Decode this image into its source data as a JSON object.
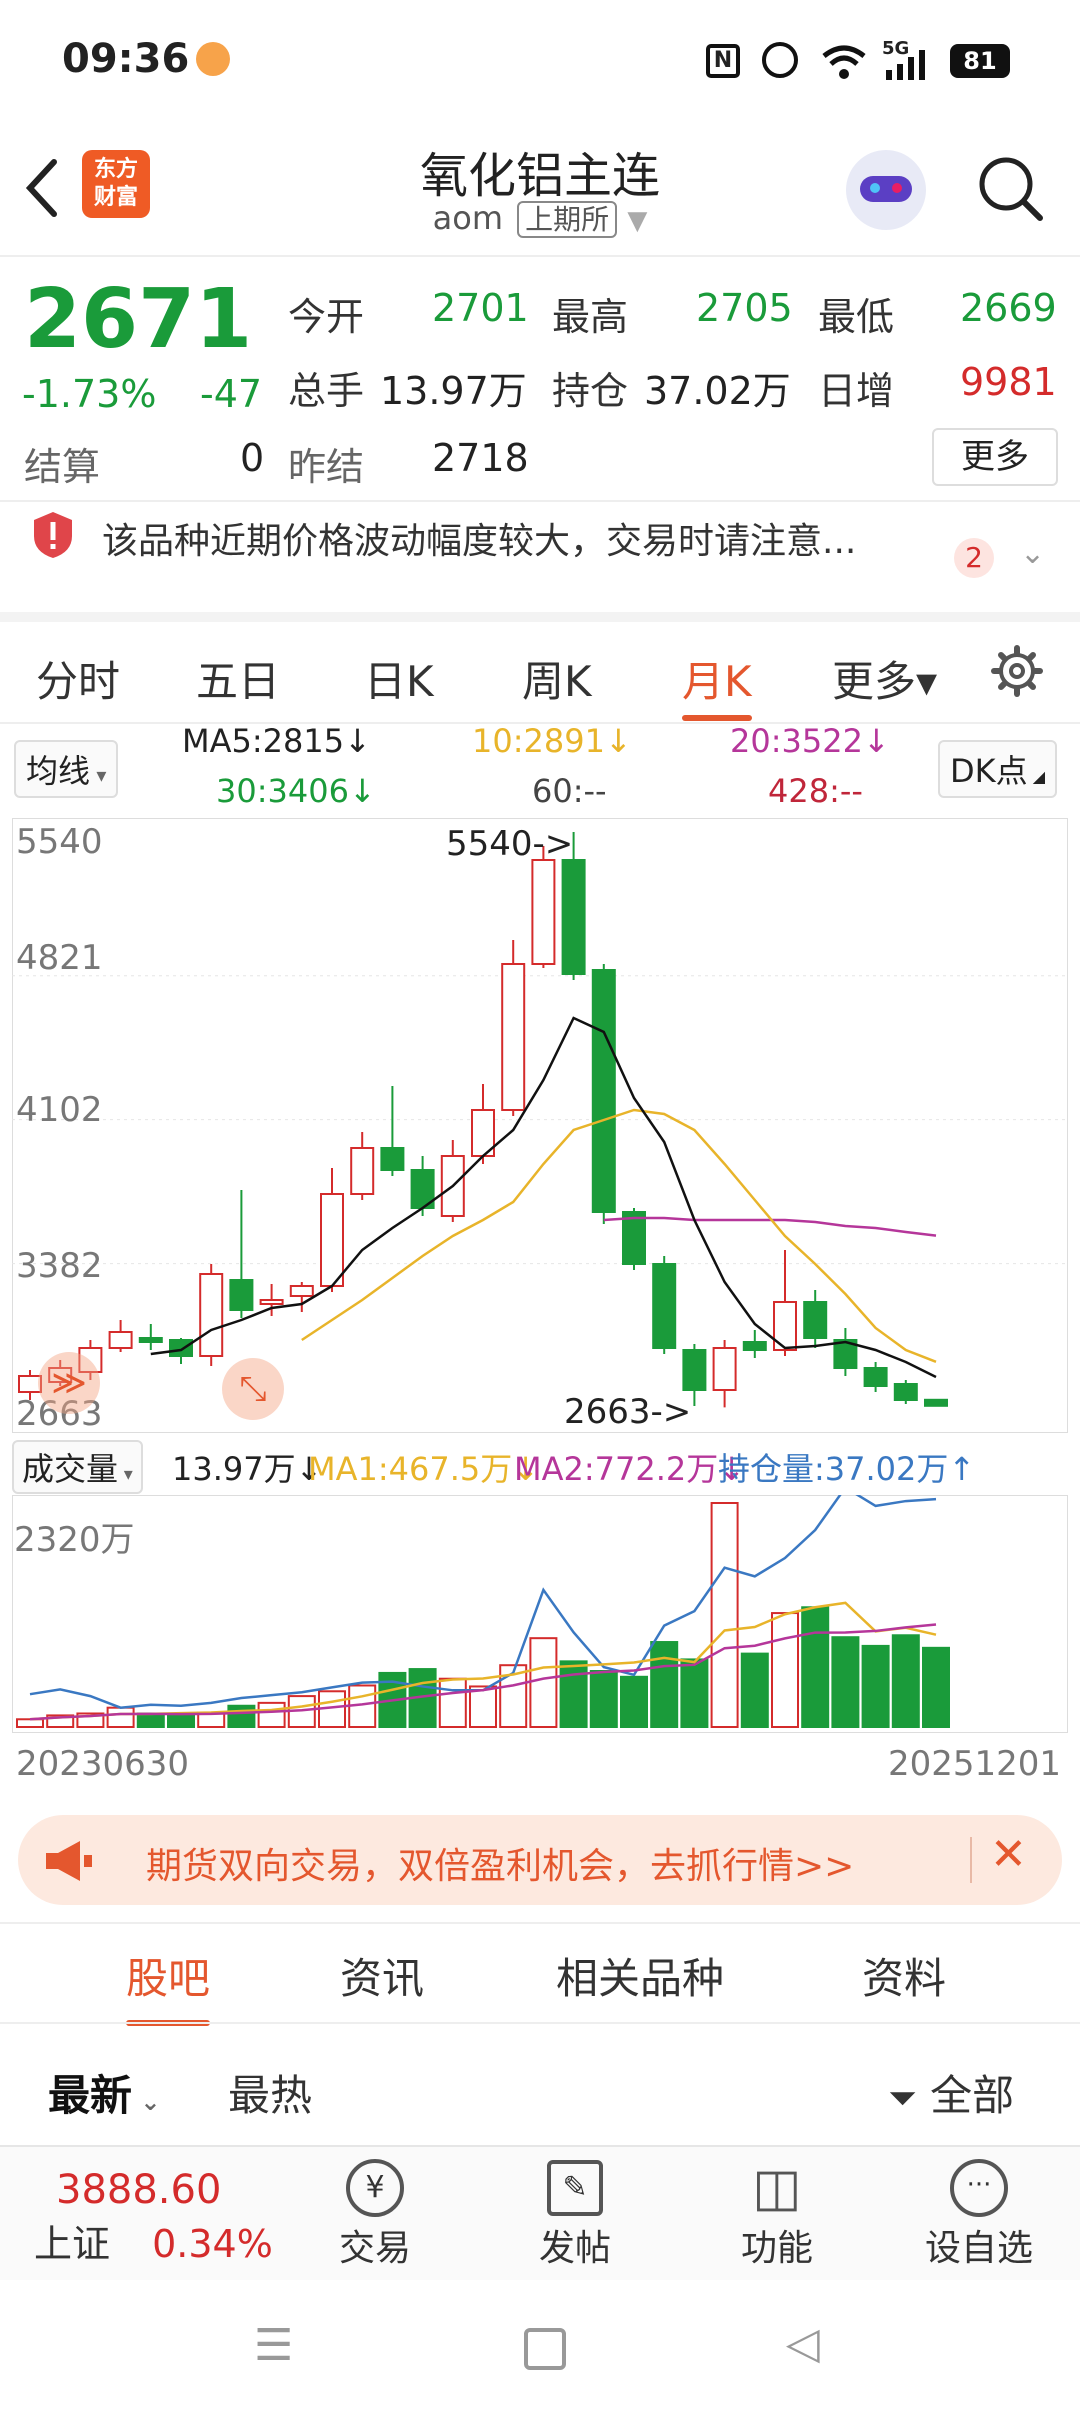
{
  "status_bar": {
    "time": "09:36",
    "battery": "81",
    "network": "5G"
  },
  "header": {
    "logo_line1": "东方",
    "logo_line2": "财富",
    "title": "氧化铝主连",
    "code": "aom",
    "exchange": "上期所"
  },
  "quote": {
    "price": "2671",
    "change_pct": "-1.73%",
    "change": "-47",
    "open_label": "今开",
    "open": "2701",
    "high_label": "最高",
    "high": "2705",
    "low_label": "最低",
    "low": "2669",
    "volume_label": "总手",
    "volume": "13.97万",
    "oi_label": "持仓",
    "oi": "37.02万",
    "daily_inc_label": "日增",
    "daily_inc": "9981",
    "settle_label": "结算",
    "settle": "0",
    "prev_settle_label": "昨结",
    "prev_settle": "2718",
    "more_label": "更多"
  },
  "warning": {
    "text": "该品种近期价格波动幅度较大，交易时请注意...",
    "count": "2"
  },
  "period_tabs": [
    "分时",
    "五日",
    "日K",
    "周K",
    "月K",
    "更多▾"
  ],
  "active_period": "月K",
  "ma": {
    "selector": "均线",
    "ma5": "MA5:2815↓",
    "ma10": "10:2891↓",
    "ma20": "20:3522↓",
    "ma30": "30:3406↓",
    "ma60": "60:--",
    "ma428": "428:--",
    "dk_label": "DK点"
  },
  "chart_data": {
    "type": "candlestick",
    "y_ticks": [
      "5540",
      "4821",
      "4102",
      "3382",
      "2663"
    ],
    "ylim": [
      2663,
      5540
    ],
    "high_annotation": "5540->",
    "low_annotation": "2663->",
    "x_start_label": "20230630",
    "x_end_label": "20251201",
    "candles": [
      {
        "o": 2740,
        "c": 2820,
        "h": 2850,
        "l": 2700
      },
      {
        "o": 2790,
        "c": 2860,
        "h": 2900,
        "l": 2770
      },
      {
        "o": 2840,
        "c": 2960,
        "h": 3000,
        "l": 2800
      },
      {
        "o": 2960,
        "c": 3040,
        "h": 3100,
        "l": 2940
      },
      {
        "o": 3010,
        "c": 2990,
        "h": 3080,
        "l": 2950
      },
      {
        "o": 3000,
        "c": 2920,
        "h": 3010,
        "l": 2880
      },
      {
        "o": 2920,
        "c": 3330,
        "h": 3380,
        "l": 2870
      },
      {
        "o": 3300,
        "c": 3150,
        "h": 3750,
        "l": 3110
      },
      {
        "o": 3180,
        "c": 3200,
        "h": 3280,
        "l": 3120
      },
      {
        "o": 3220,
        "c": 3270,
        "h": 3290,
        "l": 3140
      },
      {
        "o": 3270,
        "c": 3730,
        "h": 3860,
        "l": 3240
      },
      {
        "o": 3730,
        "c": 3960,
        "h": 4040,
        "l": 3700
      },
      {
        "o": 3960,
        "c": 3850,
        "h": 4270,
        "l": 3820
      },
      {
        "o": 3850,
        "c": 3660,
        "h": 3920,
        "l": 3620
      },
      {
        "o": 3620,
        "c": 3920,
        "h": 4000,
        "l": 3590
      },
      {
        "o": 3920,
        "c": 4150,
        "h": 4280,
        "l": 3880
      },
      {
        "o": 4150,
        "c": 4880,
        "h": 5000,
        "l": 4120
      },
      {
        "o": 4880,
        "c": 5400,
        "h": 5470,
        "l": 4860
      },
      {
        "o": 5400,
        "c": 4830,
        "h": 5540,
        "l": 4800
      },
      {
        "o": 4850,
        "c": 3640,
        "h": 4880,
        "l": 3580
      },
      {
        "o": 3640,
        "c": 3380,
        "h": 3660,
        "l": 3350
      },
      {
        "o": 3380,
        "c": 2960,
        "h": 3420,
        "l": 2930
      },
      {
        "o": 2950,
        "c": 2750,
        "h": 2980,
        "l": 2670
      },
      {
        "o": 2750,
        "c": 2960,
        "h": 3000,
        "l": 2663
      },
      {
        "o": 2990,
        "c": 2950,
        "h": 3050,
        "l": 2910
      },
      {
        "o": 2950,
        "c": 3190,
        "h": 3450,
        "l": 2920
      },
      {
        "o": 3190,
        "c": 3010,
        "h": 3250,
        "l": 2960
      },
      {
        "o": 3000,
        "c": 2860,
        "h": 3060,
        "l": 2820
      },
      {
        "o": 2860,
        "c": 2770,
        "h": 2890,
        "l": 2740
      },
      {
        "o": 2780,
        "c": 2700,
        "h": 2800,
        "l": 2680
      },
      {
        "o": 2701,
        "c": 2671,
        "h": 2705,
        "l": 2669
      }
    ],
    "ma_lines": {
      "ma5": [
        null,
        null,
        null,
        null,
        2930,
        2950,
        3050,
        3100,
        3160,
        3180,
        3270,
        3450,
        3560,
        3660,
        3770,
        3920,
        4050,
        4300,
        4610,
        4540,
        4210,
        3990,
        3600,
        3290,
        3080,
        2960,
        2970,
        2990,
        2950,
        2890,
        2815
      ],
      "ma10": [
        null,
        null,
        null,
        null,
        null,
        null,
        null,
        null,
        null,
        3000,
        3100,
        3200,
        3310,
        3420,
        3520,
        3600,
        3690,
        3880,
        4050,
        4100,
        4150,
        4130,
        4050,
        3880,
        3700,
        3520,
        3380,
        3230,
        3060,
        2950,
        2891
      ],
      "ma20": [
        null,
        null,
        null,
        null,
        null,
        null,
        null,
        null,
        null,
        null,
        null,
        null,
        null,
        null,
        null,
        null,
        null,
        null,
        null,
        3600,
        3610,
        3610,
        3600,
        3600,
        3600,
        3600,
        3590,
        3570,
        3560,
        3540,
        3522
      ]
    },
    "volume": {
      "label": "成交量",
      "vol_value": "13.97万↓",
      "ma1": "MA1:467.5万↓",
      "ma2": "MA2:772.2万↓",
      "oi": "持仓量:37.02万↑",
      "y_top_label": "2320万",
      "bars": [
        80,
        120,
        140,
        200,
        140,
        120,
        150,
        220,
        250,
        320,
        370,
        430,
        560,
        600,
        500,
        420,
        640,
        920,
        680,
        580,
        520,
        880,
        700,
        2320,
        760,
        1180,
        1240,
        930,
        840,
        950,
        820
      ],
      "oi_line": [
        340,
        390,
        320,
        200,
        230,
        220,
        250,
        300,
        330,
        360,
        410,
        460,
        470,
        420,
        380,
        380,
        560,
        1420,
        980,
        620,
        540,
        1050,
        1200,
        1650,
        1560,
        1750,
        2040,
        2480,
        2290,
        2340,
        2360
      ]
    }
  },
  "promo": {
    "text": "期货双向交易，双倍盈利机会，去抓行情>>"
  },
  "sub_tabs": [
    "股吧",
    "资讯",
    "相关品种",
    "资料"
  ],
  "filters": {
    "latest": "最新",
    "hot": "最热",
    "all": "全部"
  },
  "bottom_bar": {
    "index_value": "3888.60",
    "index_name": "上证",
    "index_change": "0.34%",
    "trade": "交易",
    "post": "发帖",
    "functions": "功能",
    "watchlist": "设自选"
  },
  "colors": {
    "up": "#d42b2b",
    "down": "#1a9b3a",
    "accent": "#e4572e"
  }
}
